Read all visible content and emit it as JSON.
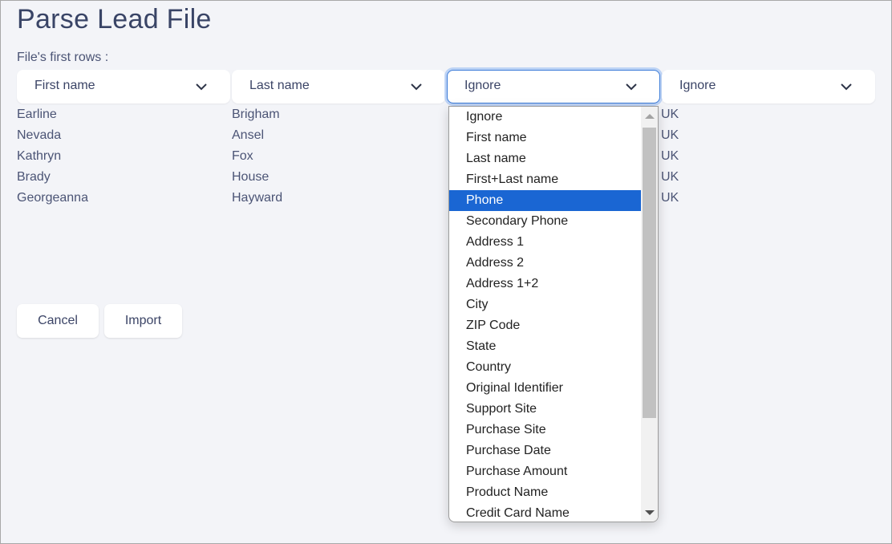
{
  "page": {
    "title": "Parse Lead File",
    "subtitle": "File's first rows :"
  },
  "columns": [
    {
      "mapping": "First name",
      "values": [
        "Earline",
        "Nevada",
        "Kathryn",
        "Brady",
        "Georgeanna"
      ]
    },
    {
      "mapping": "Last name",
      "values": [
        "Brigham",
        "Ansel",
        "Fox",
        "House",
        "Hayward"
      ]
    },
    {
      "mapping": "Ignore",
      "values": []
    },
    {
      "mapping": "Ignore",
      "values": [
        "UK",
        "UK",
        "UK",
        "UK",
        "UK"
      ]
    }
  ],
  "dropdown": {
    "highlighted": "Phone",
    "options": [
      "Ignore",
      "First name",
      "Last name",
      "First+Last name",
      "Phone",
      "Secondary Phone",
      "Address 1",
      "Address 2",
      "Address 1+2",
      "City",
      "ZIP Code",
      "State",
      "Country",
      "Original Identifier",
      "Support Site",
      "Purchase Site",
      "Purchase Date",
      "Purchase Amount",
      "Product Name",
      "Credit Card Name"
    ]
  },
  "actions": {
    "cancel_label": "Cancel",
    "import_label": "Import"
  },
  "colors": {
    "accent": "#1a66d3",
    "text": "#3b4466",
    "background": "#f3f4f8"
  }
}
